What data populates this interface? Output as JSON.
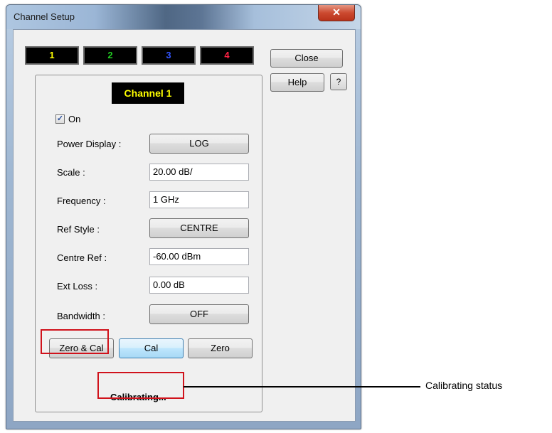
{
  "window": {
    "title": "Channel Setup",
    "close_glyph": "✕"
  },
  "tabs": [
    {
      "label": "1",
      "color": "#ffff00"
    },
    {
      "label": "2",
      "color": "#22cc22"
    },
    {
      "label": "3",
      "color": "#3355ff"
    },
    {
      "label": "4",
      "color": "#ff2244"
    }
  ],
  "buttons": {
    "close": "Close",
    "help": "Help",
    "help_icon_glyph": "?"
  },
  "channel": {
    "label": "Channel 1",
    "on_checked": true,
    "on_label": "On",
    "check_glyph": "✓"
  },
  "fields": {
    "power_display": {
      "label": "Power Display :",
      "value": "LOG"
    },
    "scale": {
      "label": "Scale :",
      "value": "20.00 dB/"
    },
    "frequency": {
      "label": "Frequency :",
      "value": "1 GHz"
    },
    "ref_style": {
      "label": "Ref Style :",
      "value": "CENTRE"
    },
    "centre_ref": {
      "label": "Centre Ref :",
      "value": "-60.00 dBm"
    },
    "ext_loss": {
      "label": "Ext Loss :",
      "value": "0.00 dB"
    },
    "bandwidth": {
      "label": "Bandwidth :",
      "value": "OFF"
    }
  },
  "actions": {
    "zero_cal": "Zero & Cal",
    "cal": "Cal",
    "zero": "Zero"
  },
  "status": "Calibrating...",
  "annotation": {
    "text": "Calibrating status",
    "highlight_color": "#d0121b"
  }
}
